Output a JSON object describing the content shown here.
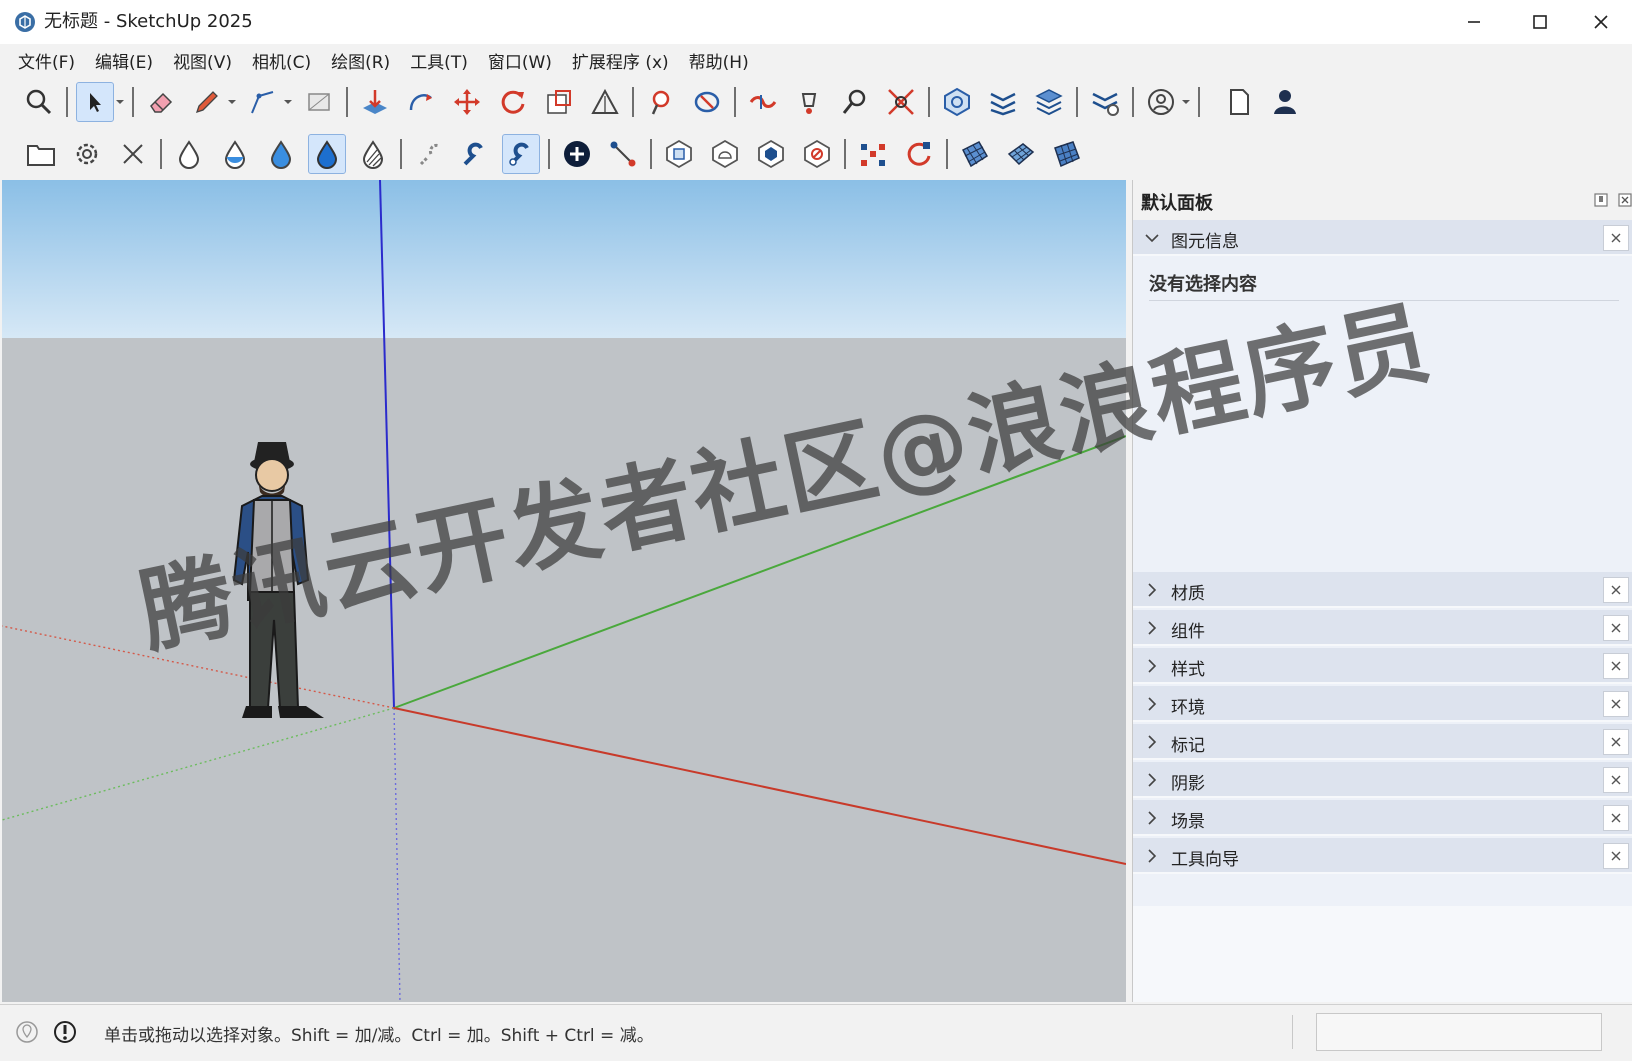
{
  "window": {
    "title": "无标题 - SketchUp 2025",
    "controls": [
      "minimize",
      "maximize",
      "close"
    ]
  },
  "menu": {
    "items": [
      "文件(F)",
      "编辑(E)",
      "视图(V)",
      "相机(C)",
      "绘图(R)",
      "工具(T)",
      "窗口(W)",
      "扩展程序 (x)",
      "帮助(H)"
    ]
  },
  "toolbar_main": {
    "icons": [
      "zoom-icon",
      "select-icon",
      "eraser-icon",
      "pencil-icon",
      "line-icon",
      "rectangle-icon",
      "push-pull-icon",
      "follow-me-icon",
      "move-icon",
      "rotate-icon",
      "scale-icon",
      "protractor-icon",
      "paint-bucket-icon",
      "orbit-icon",
      "walk-icon",
      "position-camera-icon",
      "zoom-window-icon",
      "zoom-extents-icon",
      "section-plane-icon",
      "section-display-icon",
      "tag-icon",
      "settings-icon",
      "account-icon",
      "new-file-icon",
      "profile-icon"
    ]
  },
  "toolbar_secondary": {
    "icons": [
      "folder-icon",
      "gear-icon",
      "cross-icon",
      "drop-empty-icon",
      "drop-half-icon",
      "drop-full-icon",
      "drop-active-icon",
      "drop-stripe-icon",
      "magnet-off-icon",
      "magnet-icon",
      "magnet-active-icon",
      "add-point-icon",
      "connect-icon",
      "solid-outer-icon",
      "solid-union-icon",
      "solid-intersect-icon",
      "solid-subtract-icon",
      "explode-icon",
      "refresh-icon",
      "grid-a-icon",
      "grid-b-icon",
      "grid-c-icon"
    ]
  },
  "viewport": {
    "sky_top": "#8bbfe6",
    "sky_bottom": "#d6e8f6",
    "ground": "#bfc3c7",
    "axis_blue": "#2b2bcc",
    "axis_green": "#4aa83c",
    "axis_red": "#c83a2a"
  },
  "tray": {
    "title": "默认面板",
    "entity_info": {
      "label": "图元信息",
      "empty_message": "没有选择内容"
    },
    "panels": [
      "材质",
      "组件",
      "样式",
      "环境",
      "标记",
      "阴影",
      "场景",
      "工具向导"
    ]
  },
  "status": {
    "hint": "单击或拖动以选择对象。Shift = 加/减。Ctrl = 加。Shift + Ctrl = 减。",
    "measurements_value": ""
  },
  "watermark": "腾讯云开发者社区@浪浪程序员"
}
